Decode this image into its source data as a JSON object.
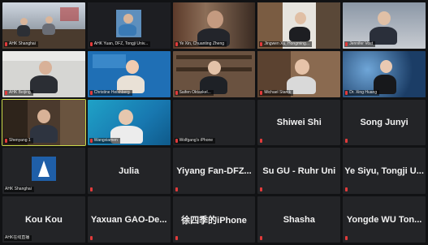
{
  "tiles": [
    {
      "name": "AHK Shanghai",
      "type": "video"
    },
    {
      "name": "AHK Yuan, DFZ, Tongji Univ...",
      "type": "video"
    },
    {
      "name": "Ye Xin, Chuanting Zheng",
      "type": "video"
    },
    {
      "name": "Jingwen Xu, Hongming...",
      "type": "video"
    },
    {
      "name": "Jennifer Vost",
      "type": "video"
    },
    {
      "name": "AHK Beijing",
      "type": "video"
    },
    {
      "name": "Christine Heishberg",
      "type": "video"
    },
    {
      "name": "Saifen Oktaskel...",
      "type": "video"
    },
    {
      "name": "Michael Starck",
      "type": "video"
    },
    {
      "name": "Dr. Xing Huang",
      "type": "video"
    },
    {
      "name": "Shenyang 1",
      "type": "video"
    },
    {
      "name": "Wangxiamen",
      "type": "video"
    },
    {
      "name": "Wolfgang's iPhone",
      "type": "name"
    },
    {
      "name": "Shiwei Shi",
      "type": "name"
    },
    {
      "name": "Song Junyi",
      "type": "name"
    },
    {
      "name": "AHK Shanghai",
      "type": "logo"
    },
    {
      "name": "Julia",
      "type": "name"
    },
    {
      "name": "Yiyang Fan-DFZ...",
      "type": "name"
    },
    {
      "name": "Su GU - Ruhr Uni",
      "type": "name"
    },
    {
      "name": "Ye Siyu, Tongji U...",
      "type": "name"
    },
    {
      "name": "Kou Kou",
      "type": "name"
    },
    {
      "name": "Yaxuan GAO-De...",
      "type": "name"
    },
    {
      "name": "徐四季的iPhone",
      "type": "name"
    },
    {
      "name": "Shasha",
      "type": "name"
    },
    {
      "name": "Yongde WU Ton...",
      "type": "name"
    }
  ],
  "bottom_left_caption": "AHK在线直播",
  "colors": {
    "background": "#111214",
    "tile": "#232427",
    "muted_mic": "#e23b3b",
    "logo_blue": "#1f5fa8"
  }
}
